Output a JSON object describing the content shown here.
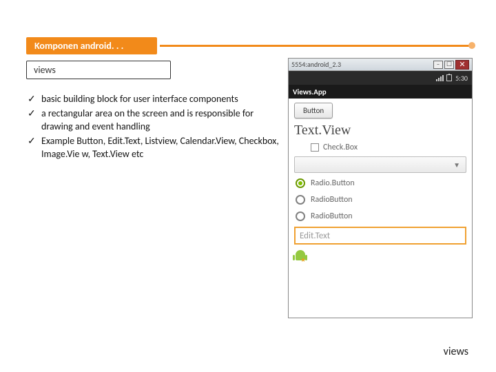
{
  "title": "Komponen android. . .",
  "subtitle": "views",
  "bullets": [
    "basic building block for user interface components",
    " a rectangular area on the screen and is responsible for drawing and event handling",
    "Example Button, Edit.Text, Listview, Calendar.View, Checkbox, Image.Vie w, Text.View etc"
  ],
  "emulator": {
    "windowTitle": "5554:android_2.3",
    "time": "5:30",
    "appName": "Views.App",
    "buttonLabel": "Button",
    "textview": "Text.View",
    "checkboxLabel": "Check.Box",
    "spinnerCaret": "▼",
    "radio1": "Radio.Button",
    "radio2": "RadioButton",
    "radio3": "RadioButton",
    "edittextHint": "Edit.Text"
  },
  "footer": "views"
}
